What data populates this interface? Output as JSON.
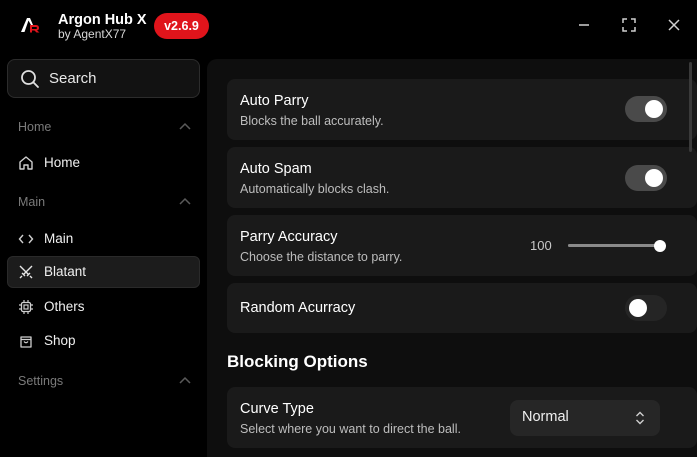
{
  "app": {
    "title": "Argon Hub X",
    "subtitle": "by AgentX77",
    "version": "v2.6.9",
    "logo_icon": "ar-logo-icon",
    "accent": "#e0141b"
  },
  "window_controls": {
    "minimize_icon": "minimize-icon",
    "maximize_icon": "maximize-icon",
    "close_icon": "close-icon"
  },
  "sidebar": {
    "search_label": "Search",
    "sections": [
      {
        "label": "Home",
        "items": [
          {
            "label": "Home",
            "icon": "house-icon"
          }
        ]
      },
      {
        "label": "Main",
        "items": [
          {
            "label": "Main",
            "icon": "code-icon"
          },
          {
            "label": "Blatant",
            "icon": "swords-icon",
            "active": true
          },
          {
            "label": "Others",
            "icon": "cpu-icon"
          },
          {
            "label": "Shop",
            "icon": "shopping-bag-icon"
          }
        ]
      },
      {
        "label": "Settings",
        "items": []
      }
    ]
  },
  "main": {
    "cards": [
      {
        "title": "Auto Parry",
        "desc": "Blocks the ball accurately.",
        "toggle": true
      },
      {
        "title": "Auto Spam",
        "desc": "Automatically blocks clash.",
        "toggle": true
      },
      {
        "title": "Parry Accuracy",
        "desc": "Choose the distance to parry.",
        "slider_value": "100",
        "slider_fraction": 1.0
      },
      {
        "title": "Random Acurracy",
        "toggle": false
      }
    ],
    "blocking_section_title": "Blocking Options",
    "curve": {
      "title": "Curve Type",
      "desc": "Select where you want to direct the ball.",
      "selected": "Normal"
    }
  }
}
